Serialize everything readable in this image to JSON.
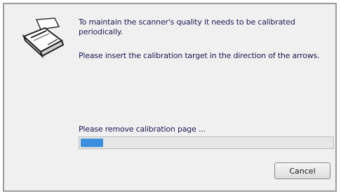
{
  "dialog": {
    "message_line1": "To maintain the scanner's quality it needs to be calibrated periodically.",
    "message_line2": "Please insert the calibration target in the direction of the arrows.",
    "status": "Please remove calibration page ...",
    "progress_fraction": 0.09,
    "progress_color": "#3a8fde",
    "cancel_label": "Cancel",
    "icon": "scanner-icon"
  }
}
